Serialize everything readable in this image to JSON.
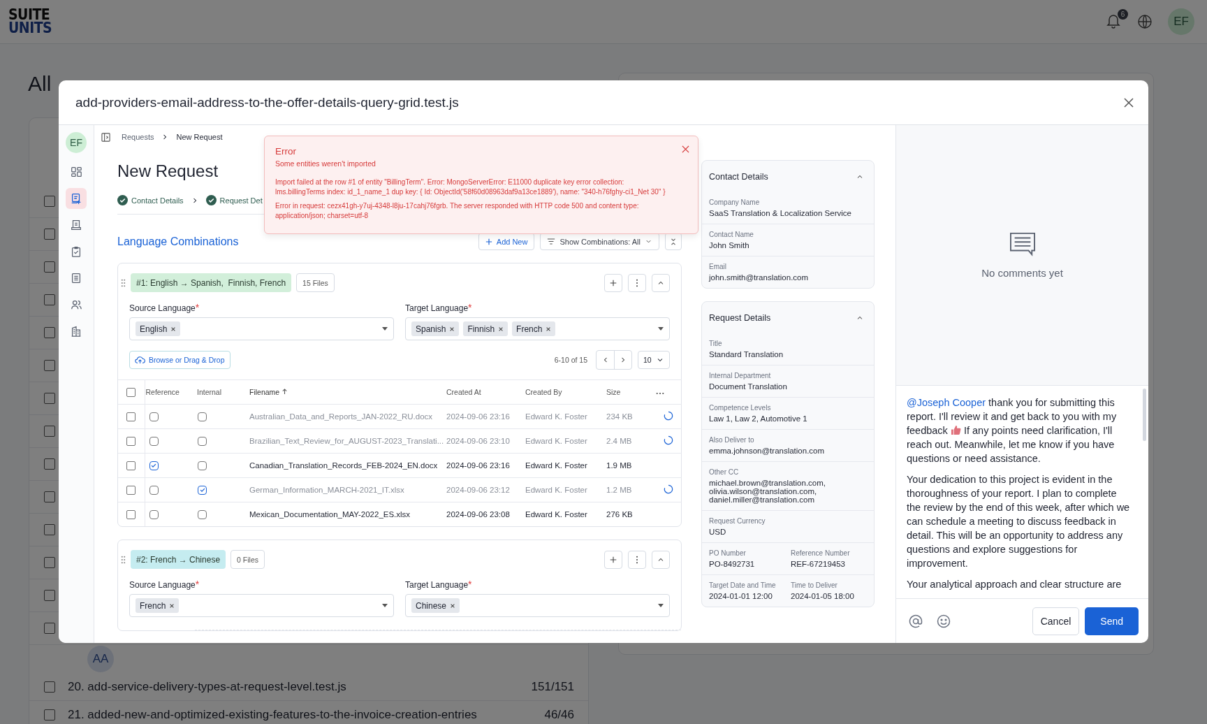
{
  "header": {
    "logo_top": "SUITE",
    "logo_bottom": "UNITS",
    "notification_count": "6",
    "avatar": "EF"
  },
  "background": {
    "title": "All",
    "avatar": "AA",
    "hidden_rows": [
      {
        "checked": false
      },
      {
        "checked": false
      },
      {
        "checked": false
      },
      {
        "checked": false
      },
      {
        "checked": false
      },
      {
        "checked": false
      },
      {
        "checked": false
      },
      {
        "checked": false
      },
      {
        "checked": false
      },
      {
        "checked": false
      },
      {
        "checked": false
      },
      {
        "checked": false
      },
      {
        "checked": false
      },
      {
        "checked": false
      }
    ],
    "rows": [
      {
        "checked": false,
        "text": "20. add-service-delivery-types-at-request-level.test.js",
        "count": "151/151"
      },
      {
        "checked": false,
        "text": "21. added-new-and-optimized-existing-features-to-the-invoice-creation-entries",
        "count": "46/46"
      }
    ]
  },
  "modal": {
    "title": "add-providers-email-address-to-the-offer-details-query-grid.test.js",
    "rail": {
      "avatar": "EF",
      "items": [
        {
          "kind": "grid",
          "selected": false
        },
        {
          "kind": "request",
          "selected": true
        },
        {
          "kind": "receipt",
          "selected": false
        },
        {
          "kind": "clipboard",
          "selected": false
        },
        {
          "kind": "list",
          "selected": false
        },
        {
          "kind": "users",
          "selected": false
        },
        {
          "kind": "building",
          "selected": false
        }
      ]
    },
    "breadcrumb": [
      "Requests",
      "New Request"
    ],
    "page_title": "New Request",
    "steps": [
      {
        "label": "Contact Details",
        "done": true
      },
      {
        "label": "Request Det",
        "done": true
      }
    ],
    "error": {
      "title": "Error",
      "subtitle": "Some entities weren't imported",
      "messages": [
        "Import failed at the row #1 of entity \"BillingTerm\". Error: MongoServerError: E11000 duplicate key error collection: lms.billingTerms index: id_1_name_1 dup key: { Id: ObjectId('58f60d08963daf9a13ce1889'), name: \"340-h76fghy-ci1_Net 30\" }",
        "Error in request: cezx41gh-y7uj-4348-l8ju-17cahj76fgrb. The server responded with HTTP code 500 and content type: application/json; charset=utf-8"
      ]
    },
    "section_title": "Language Combinations",
    "toolbar": {
      "add": "Add New",
      "filter": "Show Combinations: All"
    },
    "combinations": [
      {
        "tag": "#1: English → Spanish,  Finnish, French",
        "color": "#d2efda",
        "files": "15 Files",
        "fields": [
          {
            "label": "Source Language",
            "mark": "*",
            "tags": [
              "English"
            ]
          },
          {
            "label": "Target Language",
            "mark": "*",
            "tags": [
              "Spanish",
              "Finnish",
              "French"
            ]
          }
        ],
        "upload": "Browse or Drag & Drop",
        "range": "6-10 of 15",
        "page_size": "10",
        "table": {
          "all_selected": false,
          "columns": [
            {
              "label": "Reference",
              "sorted": false
            },
            {
              "label": "Internal",
              "sorted": false
            },
            {
              "label": "Filename",
              "sorted": true
            },
            {
              "label": "Created At",
              "sorted": false
            },
            {
              "label": "Created By",
              "sorted": false
            },
            {
              "label": "Size",
              "sorted": false
            }
          ],
          "rows": [
            {
              "selected": false,
              "reference": false,
              "internal": false,
              "uploading": true,
              "filename": "Australian_Data_and_Reports_JAN-2022_RU.docx",
              "created_at": "2024-09-06 23:16",
              "created_by": "Edward K. Foster",
              "size": "234 KB"
            },
            {
              "selected": false,
              "reference": false,
              "internal": false,
              "uploading": true,
              "filename": "Brazilian_Text_Review_for_AUGUST-2023_Translati...",
              "created_at": "2024-09-06 23:10",
              "created_by": "Edward K. Foster",
              "size": "2.4 MB"
            },
            {
              "selected": false,
              "reference": true,
              "internal": false,
              "uploading": false,
              "filename": "Canadian_Translation_Records_FEB-2024_EN.docx",
              "created_at": "2024-09-06 23:16",
              "created_by": "Edward K. Foster",
              "size": "1.9 MB"
            },
            {
              "selected": false,
              "reference": false,
              "internal": true,
              "uploading": true,
              "filename": "German_Information_MARCH-2021_IT.xlsx",
              "created_at": "2024-09-06 23:12",
              "created_by": "Edward K. Foster",
              "size": "1.2 MB"
            },
            {
              "selected": false,
              "reference": false,
              "internal": false,
              "uploading": false,
              "filename": "Mexican_Documentation_MAY-2022_ES.xlsx",
              "created_at": "2024-09-06 23:08",
              "created_by": "Edward K. Foster",
              "size": "276 KB"
            }
          ]
        }
      },
      {
        "tag": "#2: French → Chinese",
        "color": "#c5ecf0",
        "files": "0 Files",
        "fields": [
          {
            "label": "Source Language",
            "mark": "*",
            "tags": [
              "French"
            ]
          },
          {
            "label": "Target Language",
            "mark": "*",
            "tags": [
              "Chinese"
            ]
          }
        ]
      }
    ],
    "details": [
      {
        "title": "Contact Details",
        "expanded": true,
        "rows": [
          [
            {
              "label": "Company Name",
              "value": "SaaS Translation & Localization Service"
            }
          ],
          [
            {
              "label": "Contact Name",
              "value": "John Smith"
            }
          ],
          [
            {
              "label": "Email",
              "value": "john.smith@translation.com"
            }
          ]
        ]
      },
      {
        "title": "Request Details",
        "expanded": true,
        "rows": [
          [
            {
              "label": "Title",
              "value": "Standard Translation"
            }
          ],
          [
            {
              "label": "Internal Department",
              "value": "Document Translation"
            }
          ],
          [
            {
              "label": "Competence Levels",
              "value": "Law 1, Law 2, Automotive 1"
            }
          ],
          [
            {
              "label": "Also Deliver to",
              "value": "emma.johnson@translation.com"
            }
          ],
          [
            {
              "label": "Other CC",
              "value": "michael.brown@translation.com, olivia.wilson@translation.com, daniel.miller@translation.com"
            }
          ],
          [
            {
              "label": "Request Currency",
              "value": "USD"
            }
          ],
          [
            {
              "label": "PO Number",
              "value": "PO-8492731"
            },
            {
              "label": "Reference Number",
              "value": "REF-67219453"
            }
          ],
          [
            {
              "label": "Target Date and Time",
              "value": "2024-01-01 12:00"
            },
            {
              "label": "Time to Deliver",
              "value": "2024-01-05 18:00"
            }
          ]
        ]
      }
    ],
    "comments": {
      "empty_text": "No comments yet",
      "draft": {
        "mention": "@Joseph Cooper",
        "text": " thank you for submitting this report. I'll review it and get back to you with my feedback",
        "text_after_emoji": " If any points need clarification, I'll reach out. Meanwhile, let me know if you have questions or need assistance.",
        "paragraphs": [
          "Your dedication to this project is evident in the thoroughness of your report. I plan to complete the review by the end of this week, after which we can schedule a meeting to discuss feedback in detail. This will be an opportunity to address any questions and explore suggestions for improvement.",
          "Your analytical approach and clear structure are"
        ]
      },
      "cancel": "Cancel",
      "send": "Send"
    }
  }
}
